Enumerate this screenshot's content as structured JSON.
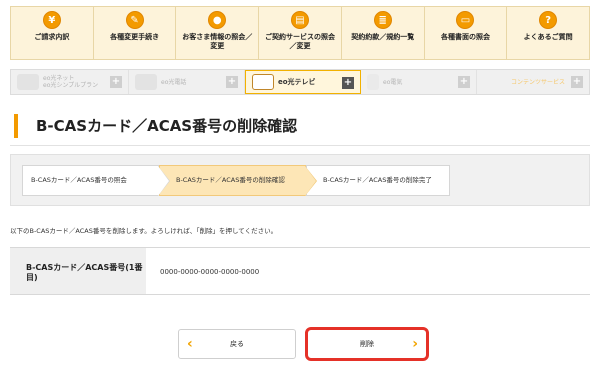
{
  "topnav": {
    "items": [
      {
        "label": "ご請求内訳",
        "icon": "yen-icon",
        "glyph": "¥"
      },
      {
        "label": "各種変更手続き",
        "icon": "edit-icon",
        "glyph": "✎"
      },
      {
        "label": "お客さま情報の照会／変更",
        "icon": "person-icon",
        "glyph": "●"
      },
      {
        "label": "ご契約サービスの照会／変更",
        "icon": "document-icon",
        "glyph": "▤"
      },
      {
        "label": "契約約款／規約一覧",
        "icon": "list-icon",
        "glyph": "≣"
      },
      {
        "label": "各種書面の照会",
        "icon": "card-icon",
        "glyph": "▭"
      },
      {
        "label": "よくあるご質問",
        "icon": "question-icon",
        "glyph": "?"
      }
    ]
  },
  "services": {
    "items": [
      {
        "label": "eo光ネット\neo光シンプルプラン",
        "active": false
      },
      {
        "label": "eo光電話",
        "active": false
      },
      {
        "label": "eo光テレビ",
        "active": true
      },
      {
        "label": "eo電気",
        "active": false
      },
      {
        "label": "コンテンツサービス",
        "active": false
      }
    ],
    "plus": "+"
  },
  "page": {
    "title": "B-CASカード／ACAS番号の削除確認"
  },
  "steps": {
    "step1": "B-CASカード／ACAS番号の照会",
    "step2": "B-CASカード／ACAS番号の削除確認",
    "step3": "B-CASカード／ACAS番号の削除完了"
  },
  "notice": "以下のB-CASカード／ACAS番号を削除します。よろしければ、「削除」を押してください。",
  "info": {
    "label": "B-CASカード／ACAS番号(1番目)",
    "value": "0000-0000-0000-0000-0000"
  },
  "buttons": {
    "back": "戻る",
    "delete": "削除",
    "back_chevron": "‹",
    "delete_chevron": "›"
  },
  "colors": {
    "accent": "#f39a00",
    "highlight": "#e53128",
    "step_active": "#fde6b6"
  }
}
